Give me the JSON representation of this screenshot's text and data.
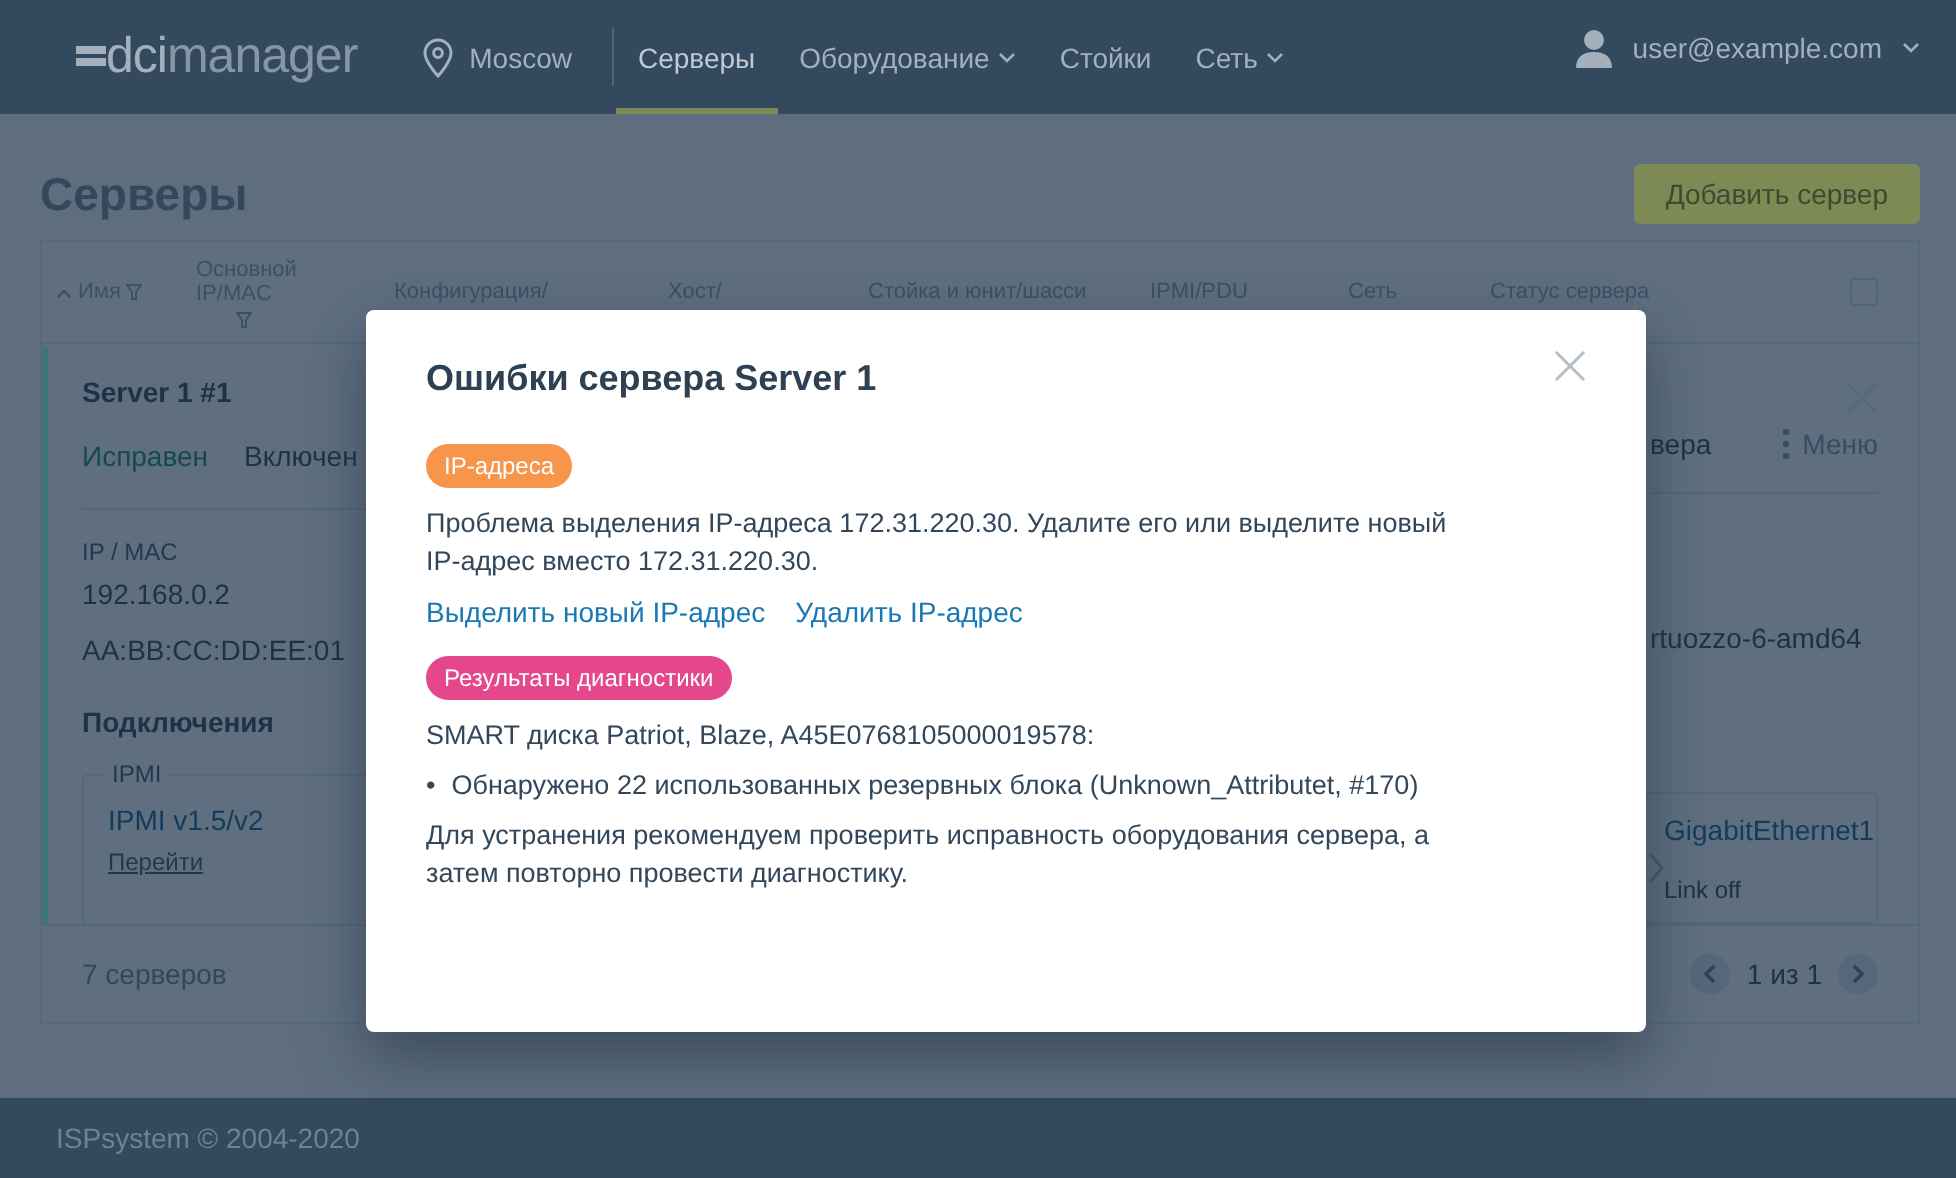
{
  "header": {
    "logo_left": "dci",
    "logo_right": "manager",
    "location": "Moscow",
    "nav": [
      {
        "label": "Серверы",
        "selected": true,
        "dropdown": false
      },
      {
        "label": "Оборудование",
        "selected": false,
        "dropdown": true
      },
      {
        "label": "Стойки",
        "selected": false,
        "dropdown": false
      },
      {
        "label": "Сеть",
        "selected": false,
        "dropdown": true
      }
    ],
    "user": "user@example.com"
  },
  "page": {
    "title": "Серверы",
    "add_button": "Добавить сервер"
  },
  "table": {
    "columns": [
      {
        "label": "Имя",
        "sorted": true,
        "filter": true
      },
      {
        "label": "Основной IP/MAC",
        "sorted": false,
        "filter": true
      },
      {
        "label": "Конфигурация/",
        "sorted": false,
        "filter": false
      },
      {
        "label": "Хост/",
        "sorted": false,
        "filter": false
      },
      {
        "label": "Стойка и юнит/шасси",
        "sorted": false,
        "filter": false
      },
      {
        "label": "IPMI/PDU",
        "sorted": false,
        "filter": false
      },
      {
        "label": "Сеть",
        "sorted": false,
        "filter": false
      },
      {
        "label": "Статус сервера",
        "sorted": false,
        "filter": false
      }
    ],
    "server": {
      "name": "Server 1 #1",
      "health": "Исправен",
      "power": "Включен",
      "status_partial": "вера",
      "menu": "Меню",
      "ip_label": "IP / MAC",
      "ip": "192.168.0.2",
      "mac": "AA:BB:CC:DD:EE:01",
      "platform_partial": "rtuozzo-6-amd64",
      "connections_title": "Подключения",
      "ipmi": {
        "legend": "IPMI",
        "name": "IPMI v1.5/v2",
        "link": "Перейти"
      },
      "network": {
        "name": "GigabitEthernet1",
        "state": "Link off"
      }
    },
    "select_all": {
      "checked": false
    },
    "count": "7 серверов",
    "pager": "1 из 1"
  },
  "dialog": {
    "title": "Ошибки сервера Server 1",
    "sections": [
      {
        "tag": "IP-адреса",
        "color": "#f7954a",
        "blocks": [
          {
            "kind": "text",
            "text": "Проблема выделения IP-адреса 172.31.220.30. Удалите его или выделите новый IP-адрес вместо 172.31.220.30."
          },
          {
            "kind": "links",
            "items": [
              "Выделить новый IP-адрес",
              "Удалить IP-адрес"
            ]
          }
        ]
      },
      {
        "tag": "Результаты диагностики",
        "color": "#e4478b",
        "blocks": [
          {
            "kind": "text",
            "text": "SMART диска Patriot, Blaze, A45E0768105000019578:"
          },
          {
            "kind": "bullets",
            "marker": "•",
            "items": [
              "Обнаружено 22 использованных резервных блока (Unknown_Attributet, #170)"
            ]
          },
          {
            "kind": "text",
            "text": "Для устранения рекомендуем проверить исправность оборудования сервера, а затем повторно провести диагностику."
          }
        ]
      }
    ]
  },
  "footer": "ISPsystem © 2004-2020"
}
